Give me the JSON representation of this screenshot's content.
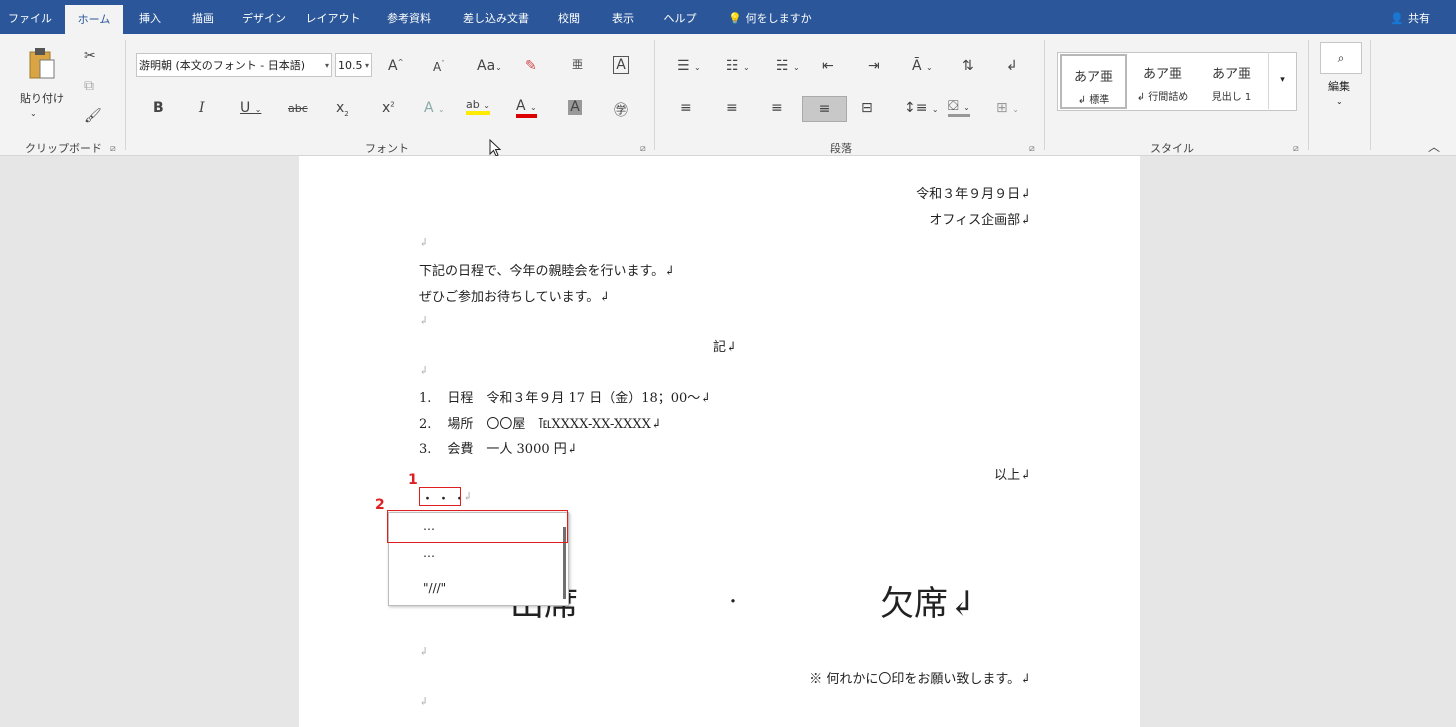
{
  "tabs": [
    "ファイル",
    "ホーム",
    "挿入",
    "描画",
    "デザイン",
    "レイアウト",
    "参考資料",
    "差し込み文書",
    "校閲",
    "表示",
    "ヘルプ"
  ],
  "active_tab": "ホーム",
  "tell_me": "何をしますか",
  "share": "共有",
  "ribbon": {
    "clipboard": {
      "paste": "貼り付け",
      "label": "クリップボード"
    },
    "font": {
      "name": "游明朝 (本文のフォント - 日本語)",
      "size": "10.5",
      "label": "フォント"
    },
    "paragraph": {
      "label": "段落"
    },
    "styles": {
      "label": "スタイル",
      "items": [
        {
          "preview": "あア亜",
          "name": "↲ 標準"
        },
        {
          "preview": "あア亜",
          "name": "↲ 行間詰め"
        },
        {
          "preview": "あア亜",
          "name": "見出し 1"
        }
      ]
    },
    "editing": {
      "label": "編集"
    }
  },
  "doc": {
    "date": "令和３年９月９日↲",
    "dept": "オフィス企画部↲",
    "para1": "下記の日程で、今年の親睦会を行います。↲",
    "para2": "ぜひご参加お待ちしています。↲",
    "ki": "記↲",
    "items": [
      {
        "num": "1.",
        "text": "日程　令和３年９月 17 日（金）18；00〜↲"
      },
      {
        "num": "2.",
        "text": "場所　〇〇屋　℡XXXX-XX-XXXX↲"
      },
      {
        "num": "3.",
        "text": "会費　一人 3000 円↲"
      }
    ],
    "ijou": "以上↲",
    "typed": "・・・",
    "attend_left": "出席",
    "attend_dot": "・",
    "attend_right": "欠席↲",
    "note": "※ 何れかに〇印をお願い致します。↲",
    "return_mark": "↲"
  },
  "autocorrect": [
    "…",
    "⋯",
    "\"///\""
  ],
  "annotations": [
    "1",
    "2"
  ]
}
